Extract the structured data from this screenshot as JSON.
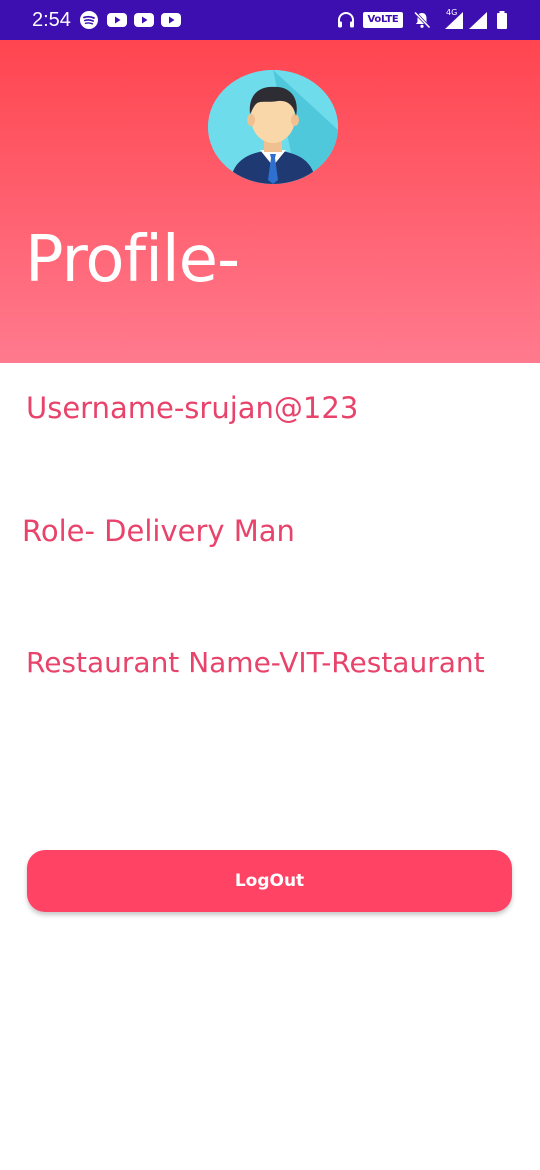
{
  "status_bar": {
    "time": "2:54",
    "volte_label": "VoLTE",
    "network_label": "4G",
    "background_color": "#3d0fb0",
    "left_icons": [
      "spotify-icon",
      "youtube-icon",
      "youtube-icon",
      "youtube-icon"
    ],
    "right_icons": [
      "headphones-icon",
      "volte-icon",
      "bell-muted-icon",
      "signal-icon",
      "signal-icon",
      "battery-icon"
    ]
  },
  "header": {
    "title": "Profile-",
    "avatar_icon": "businessman-avatar-icon",
    "gradient_top_color": "#ff4550",
    "gradient_bottom_color": "#ff7a8e"
  },
  "profile": {
    "username": "Username-srujan@123",
    "role": "Role- Delivery Man",
    "restaurant": "Restaurant Name-VIT-Restaurant",
    "text_color": "#e8436a"
  },
  "actions": {
    "logout_label": "LogOut",
    "logout_color": "#ff4364"
  }
}
